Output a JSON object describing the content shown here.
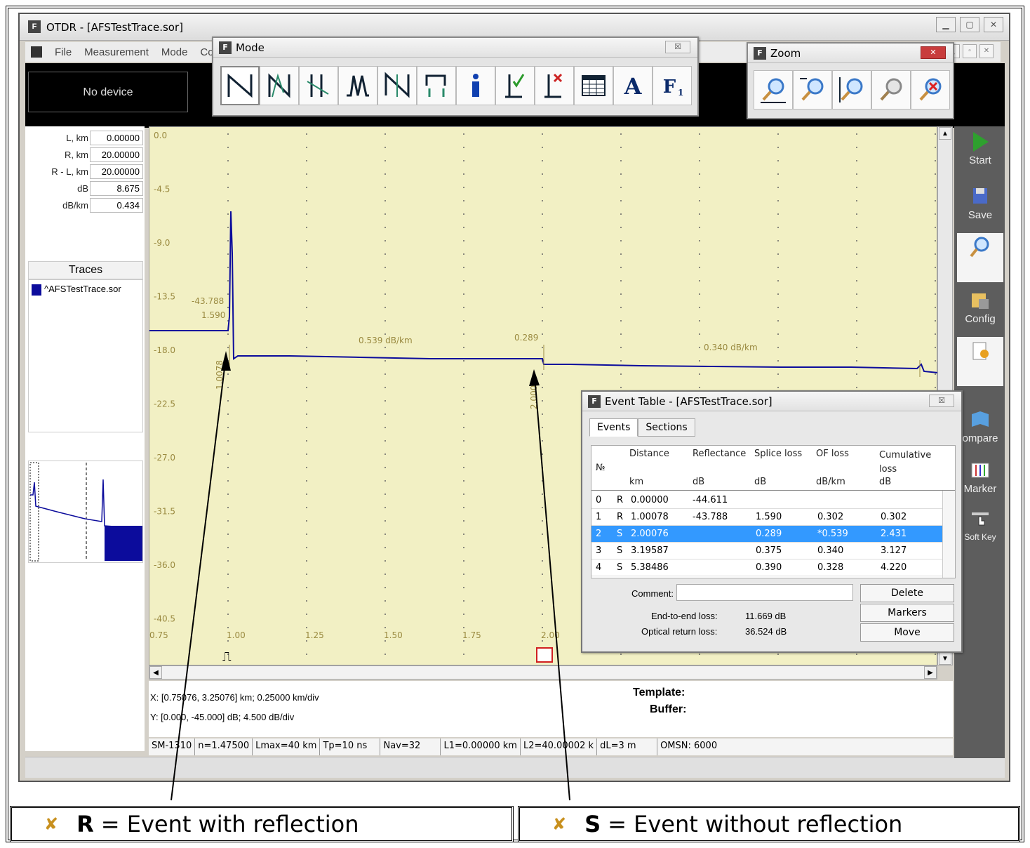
{
  "app": {
    "title": "OTDR - [AFSTestTrace.sor]",
    "menu": [
      "File",
      "Measurement",
      "Mode",
      "Co"
    ],
    "device_status": "No device"
  },
  "params": [
    {
      "label": "L, km",
      "value": "0.00000"
    },
    {
      "label": "R, km",
      "value": "20.00000"
    },
    {
      "label": "R - L, km",
      "value": "20.00000"
    },
    {
      "label": "dB",
      "value": "8.675"
    },
    {
      "label": "dB/km",
      "value": "0.434"
    }
  ],
  "traces": {
    "header": "Traces",
    "items": [
      {
        "name": "^AFSTestTrace.sor",
        "color": "#0c0c9c"
      }
    ]
  },
  "mode_window": {
    "title": "Mode",
    "close": "☒"
  },
  "zoom_window": {
    "title": "Zoom",
    "close": "✕"
  },
  "plot": {
    "y_ticks": [
      "0.0",
      "-4.5",
      "-9.0",
      "-13.5",
      "-18.0",
      "-22.5",
      "-27.0",
      "-31.5",
      "-36.0",
      "-40.5"
    ],
    "x_ticks": [
      "0.75",
      "1.00",
      "1.25",
      "1.50",
      "1.75",
      "2.00"
    ],
    "annotations": {
      "refl": "-43.788",
      "splice1": "1.590",
      "atten1": "0.539 dB/km",
      "splice2": "0.289",
      "atten2": "0.340 dB/km",
      "marker1": "1.0078",
      "marker2": "2.0008"
    },
    "trace_color": "#0c0c9c",
    "background": "#f2f0c4",
    "label_color": "#9a8a40"
  },
  "info": {
    "x_line": "X: [0.75076, 3.25076] km; 0.25000 km/div",
    "y_line": "Y: [0.000, -45.000] dB; 4.500 dB/div",
    "template_label": "Template:",
    "buffer_label": "Buffer:"
  },
  "status_bar": [
    "SM-1310",
    "n=1.47500",
    "Lmax=40 km",
    "Tp=10 ns",
    "Nav=32",
    "L1=0.00000 km",
    "L2=40.00002 k",
    "dL=3 m",
    "OMSN: 6000"
  ],
  "right_toolbar": [
    {
      "label": "Start",
      "icon": "play-icon"
    },
    {
      "label": "Save",
      "icon": "save-icon"
    },
    {
      "label": "",
      "icon": "magnifier-icon"
    },
    {
      "label": "Config",
      "icon": "config-icon"
    },
    {
      "label": "",
      "icon": "report-icon"
    },
    {
      "label": "ompare",
      "icon": "compare-icon"
    },
    {
      "label": "Marker",
      "icon": "marker-icon"
    },
    {
      "label": "Soft Key",
      "icon": "soft-key-icon"
    }
  ],
  "event_table": {
    "title": "Event Table - [AFSTestTrace.sor]",
    "tabs": [
      "Events",
      "Sections"
    ],
    "headers": {
      "no": "№",
      "distance": "Distance",
      "distance_unit": "km",
      "reflectance": "Reflectance",
      "reflectance_unit": "dB",
      "splice": "Splice loss",
      "splice_unit": "dB",
      "of": "OF loss",
      "of_unit": "dB/km",
      "cumulative": "Cumulative loss",
      "cumulative_unit": "dB"
    },
    "rows": [
      {
        "no": "0",
        "type": "R",
        "distance": "0.00000",
        "reflectance": "-44.611",
        "splice": "",
        "of": "",
        "cumulative": ""
      },
      {
        "no": "1",
        "type": "R",
        "distance": "1.00078",
        "reflectance": "-43.788",
        "splice": "1.590",
        "of": "0.302",
        "cumulative": "0.302"
      },
      {
        "no": "2",
        "type": "S",
        "distance": "2.00076",
        "reflectance": "",
        "splice": "0.289",
        "of": "*0.539",
        "cumulative": "2.431"
      },
      {
        "no": "3",
        "type": "S",
        "distance": "3.19587",
        "reflectance": "",
        "splice": "0.375",
        "of": "0.340",
        "cumulative": "3.127"
      },
      {
        "no": "4",
        "type": "S",
        "distance": "5.38486",
        "reflectance": "",
        "splice": "0.390",
        "of": "0.328",
        "cumulative": "4.220"
      }
    ],
    "selected_row": 2,
    "comment_label": "Comment:",
    "end_to_end_label": "End-to-end loss:",
    "end_to_end_value": "11.669 dB",
    "orl_label": "Optical return loss:",
    "orl_value": "36.524 dB",
    "buttons": [
      "Delete",
      "Markers",
      "Move"
    ]
  },
  "legend": [
    {
      "mark": "✘",
      "key": "R",
      "text": "= Event with reflection"
    },
    {
      "mark": "✘",
      "key": "S",
      "text": "= Event without reflection"
    }
  ]
}
